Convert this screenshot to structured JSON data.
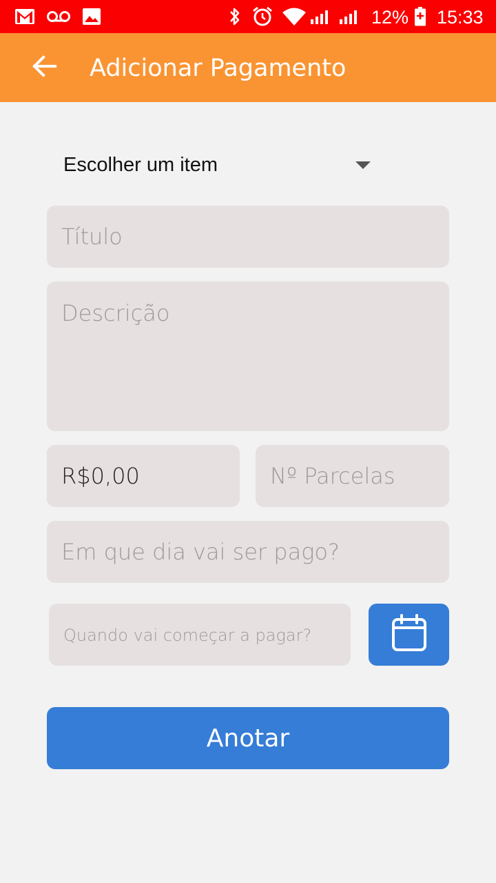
{
  "status_bar": {
    "icons": [
      "gmail-icon",
      "voicemail-icon",
      "image-icon",
      "bluetooth-icon",
      "alarm-icon",
      "wifi-icon",
      "signal-icon",
      "signal-icon",
      "battery-charging-icon"
    ],
    "battery": "12%",
    "time": "15:33",
    "background": "#fa0000"
  },
  "app_bar": {
    "title": "Adicionar Pagamento",
    "back_icon": "arrow-left-icon",
    "background": "#fa9433"
  },
  "form": {
    "item_select": {
      "value": "Escolher um item"
    },
    "title_field": {
      "placeholder": "Título"
    },
    "description_field": {
      "placeholder": "Descrição"
    },
    "amount_field": {
      "value": "R$0,00"
    },
    "installments_field": {
      "placeholder": "Nº Parcelas"
    },
    "pay_day_field": {
      "placeholder": "Em que dia vai ser pago?"
    },
    "start_date_field": {
      "placeholder": "Quando vai começar a pagar?"
    },
    "calendar_icon": "calendar-icon",
    "submit_label": "Anotar"
  },
  "colors": {
    "accent_blue": "#357dd6",
    "field_background": "#e6e0e0",
    "page_background": "#f2f2f2"
  }
}
